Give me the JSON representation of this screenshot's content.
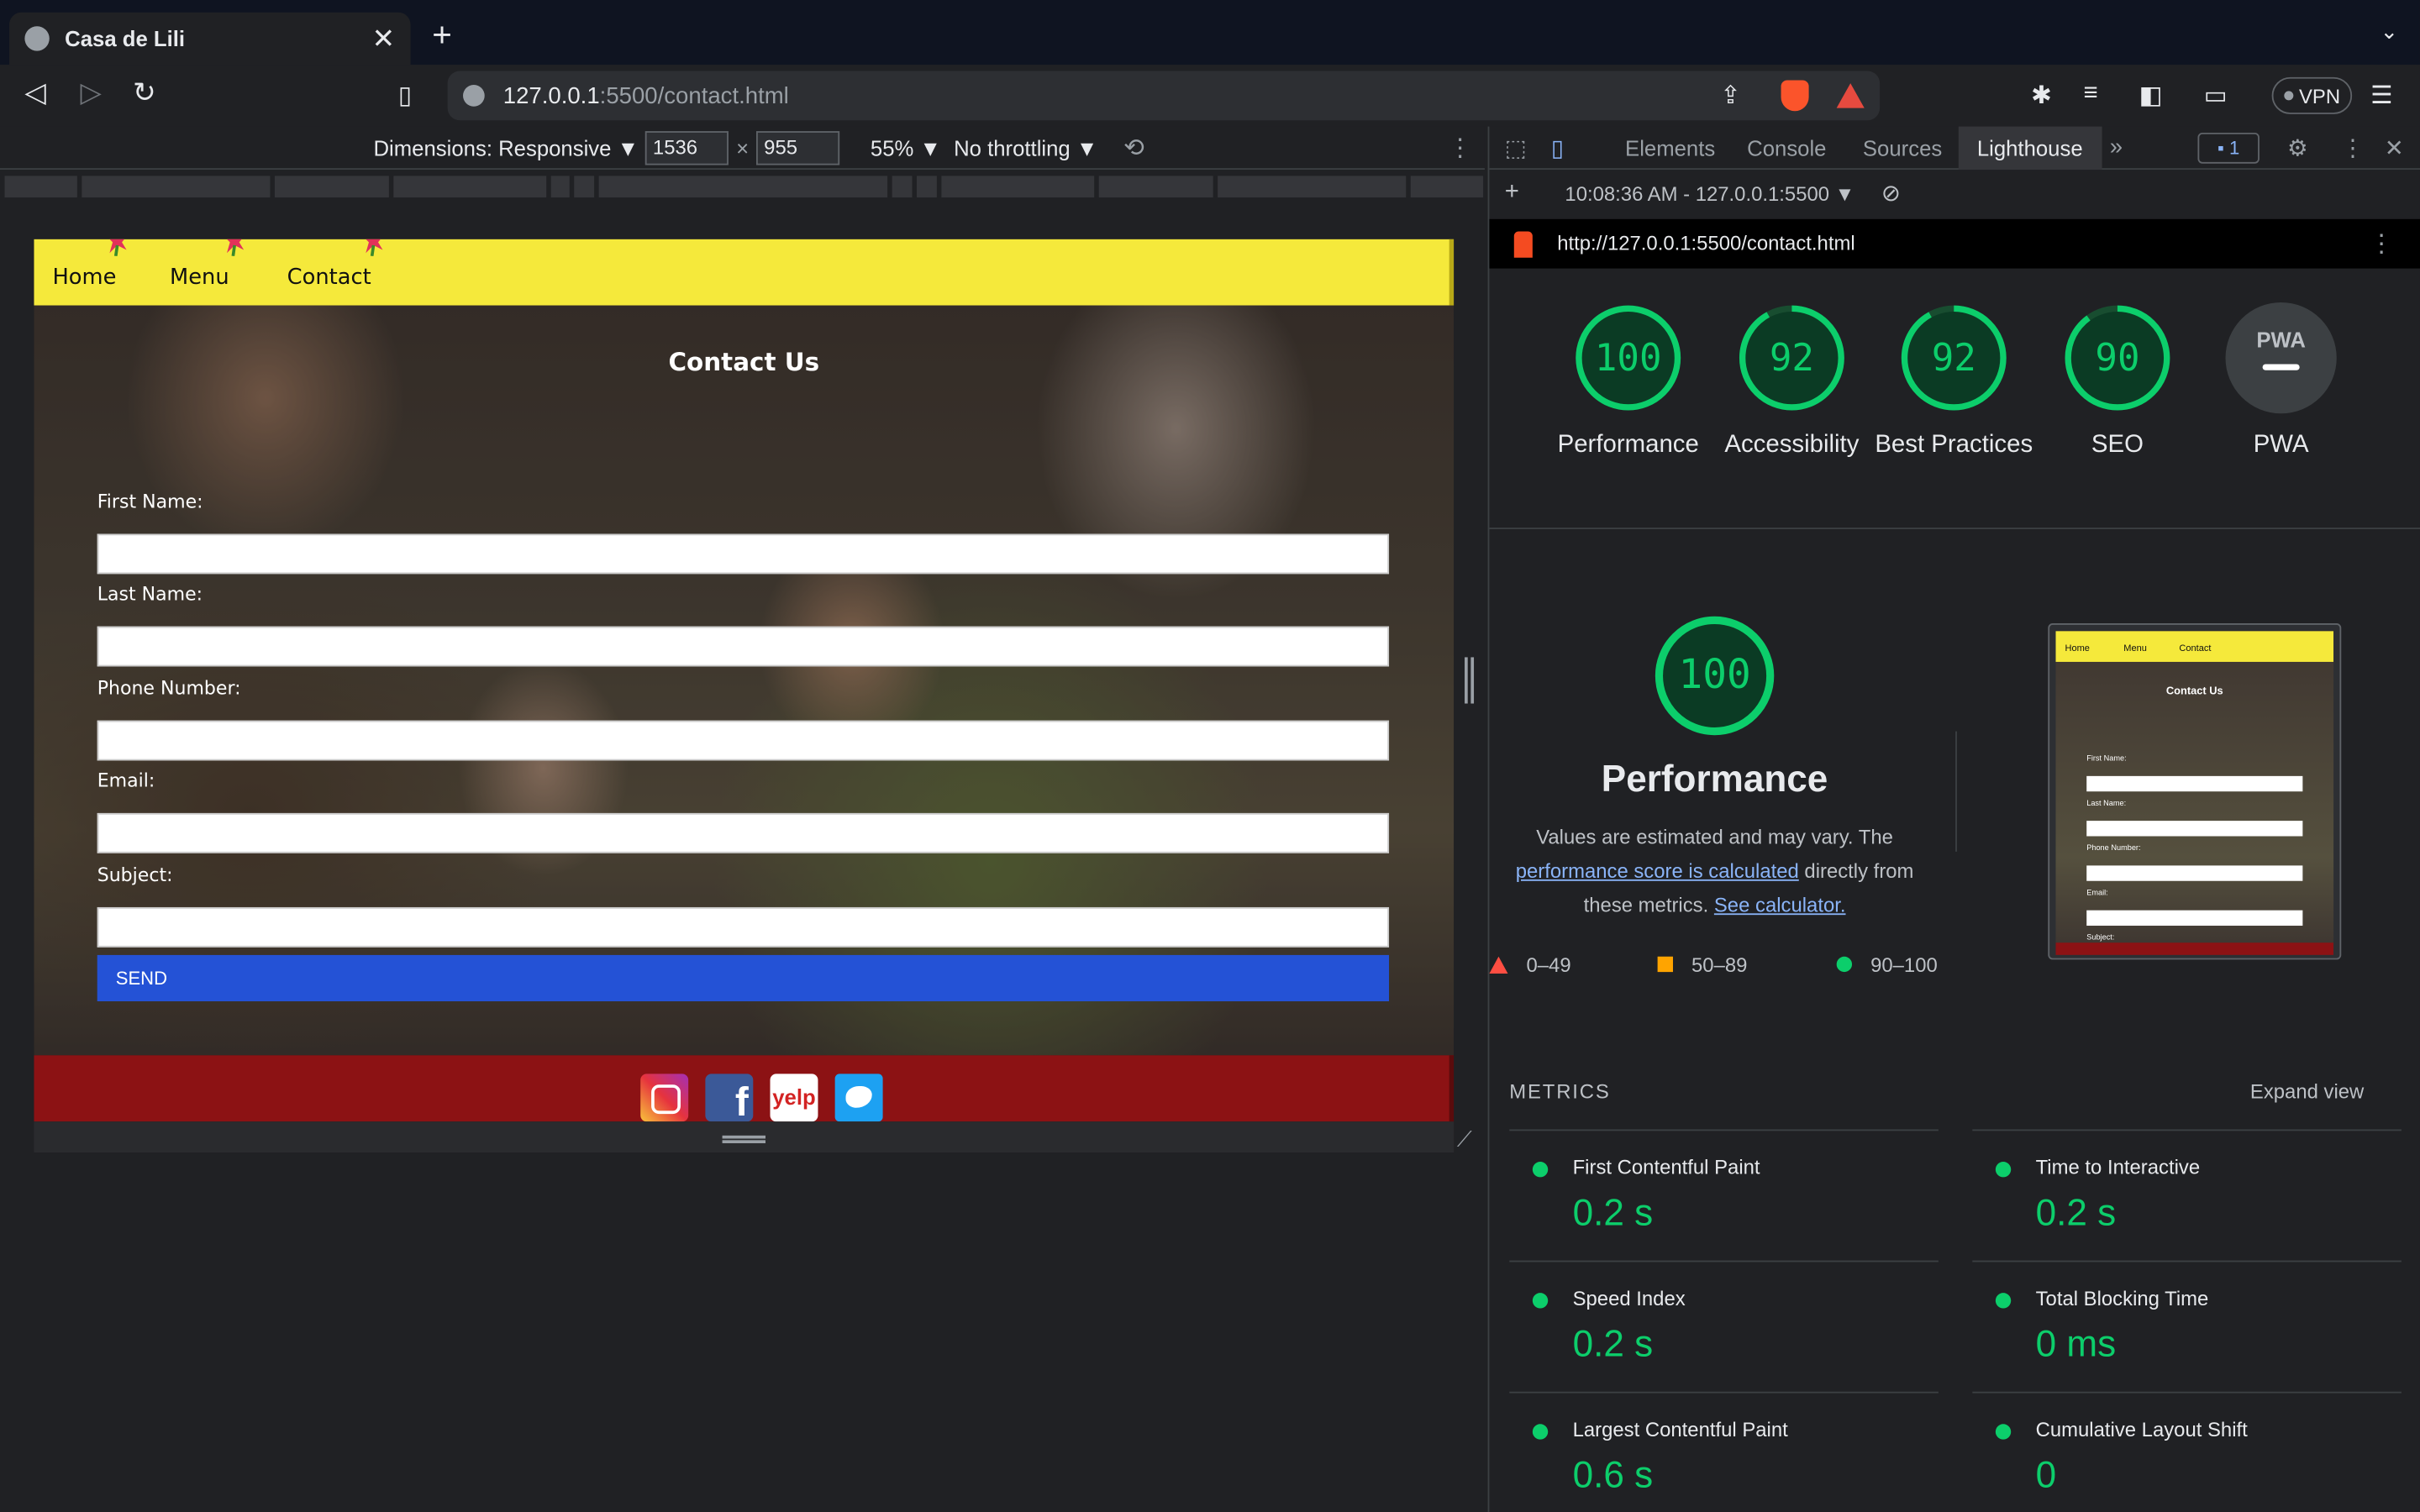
{
  "browser": {
    "tab_title": "Casa de Lili",
    "tab_close": "✕",
    "new_tab": "+",
    "url_host": "127.0.0.1",
    "url_path": ":5500/contact.html",
    "vpn_label": "VPN"
  },
  "device_toolbar": {
    "dimensions_label": "Dimensions: Responsive ▼",
    "width_value": "1536",
    "times": "×",
    "height_value": "955",
    "zoom": "55% ▼",
    "throttling": "No throttling ▼"
  },
  "site": {
    "nav": [
      "Home",
      "Menu",
      "Contact"
    ],
    "heading": "Contact Us",
    "fields": [
      "First Name:",
      "Last Name:",
      "Phone Number:",
      "Email:",
      "Subject:"
    ],
    "send_label": "SEND",
    "social": {
      "facebook": "f",
      "yelp": "yelp"
    }
  },
  "devtools": {
    "tabs": [
      "Elements",
      "Console",
      "Sources",
      "Lighthouse"
    ],
    "more": "»",
    "issues_count": "1",
    "report_time": "10:08:36 AM - 127.0.0.1:5500 ▼",
    "report_url": "http://127.0.0.1:5500/contact.html",
    "scores": [
      {
        "label": "Performance",
        "value": 100
      },
      {
        "label": "Accessibility",
        "value": 92
      },
      {
        "label": "Best Practices",
        "value": 92
      },
      {
        "label": "SEO",
        "value": 90
      }
    ],
    "pwa_label": "PWA",
    "pwa_badge": "PWA",
    "performance": {
      "score": "100",
      "title": "Performance",
      "desc_1": "Values are estimated and may vary. The ",
      "desc_link": "performance score is calculated",
      "desc_2": " directly from these metrics. ",
      "desc_link2": "See calculator."
    },
    "legend": [
      "0–49",
      "50–89",
      "90–100"
    ],
    "thumbnail": {
      "nav": [
        "Home",
        "Menu",
        "Contact"
      ],
      "heading": "Contact Us",
      "fields": [
        "First Name:",
        "Last Name:",
        "Phone Number:",
        "Email:",
        "Subject:"
      ]
    },
    "metrics_title": "METRICS",
    "expand_label": "Expand view",
    "metrics": [
      {
        "label": "First Contentful Paint",
        "value": "0.2 s"
      },
      {
        "label": "Time to Interactive",
        "value": "0.2 s"
      },
      {
        "label": "Speed Index",
        "value": "0.2 s"
      },
      {
        "label": "Total Blocking Time",
        "value": "0 ms"
      },
      {
        "label": "Largest Contentful Paint",
        "value": "0.6 s"
      },
      {
        "label": "Cumulative Layout Shift",
        "value": "0"
      }
    ]
  },
  "colors": {
    "good": "#0cce6b",
    "nav_yellow": "#f5e93b",
    "footer_red": "#8c1214",
    "send_blue": "#2452d6"
  }
}
